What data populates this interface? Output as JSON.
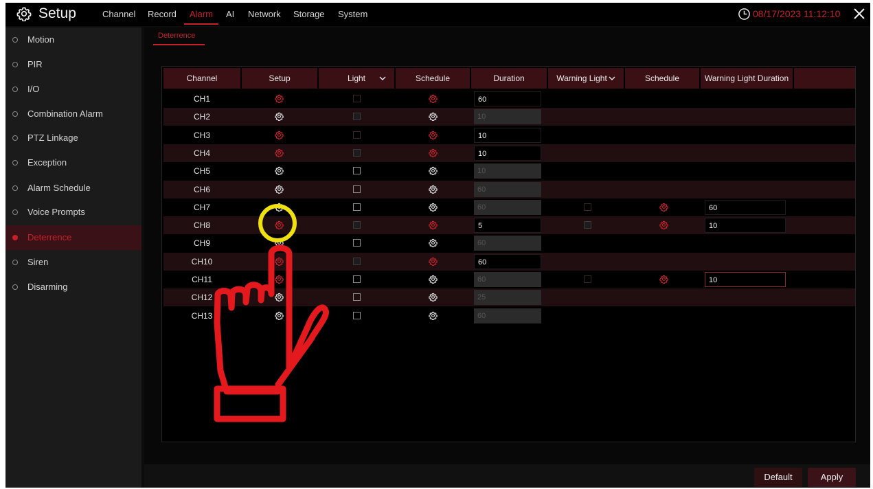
{
  "app": {
    "title": "Setup",
    "datetime": "08/17/2023 11:12:10"
  },
  "topnav": {
    "tabs": [
      {
        "label": "Channel",
        "active": false
      },
      {
        "label": "Record",
        "active": false
      },
      {
        "label": "Alarm",
        "active": true
      },
      {
        "label": "AI",
        "active": false
      },
      {
        "label": "Network",
        "active": false
      },
      {
        "label": "Storage",
        "active": false
      },
      {
        "label": "System",
        "active": false
      }
    ]
  },
  "sidebar": {
    "items": [
      {
        "label": "Motion",
        "active": false
      },
      {
        "label": "PIR",
        "active": false
      },
      {
        "label": "I/O",
        "active": false
      },
      {
        "label": "Combination Alarm",
        "active": false
      },
      {
        "label": "PTZ Linkage",
        "active": false
      },
      {
        "label": "Exception",
        "active": false
      },
      {
        "label": "Alarm Schedule",
        "active": false
      },
      {
        "label": "Voice Prompts",
        "active": false
      },
      {
        "label": "Deterrence",
        "active": true
      },
      {
        "label": "Siren",
        "active": false
      },
      {
        "label": "Disarming",
        "active": false
      }
    ]
  },
  "content": {
    "subtab": "Deterrence"
  },
  "table": {
    "headers": {
      "channel": "Channel",
      "setup": "Setup",
      "light": "Light",
      "schedule": "Schedule",
      "duration": "Duration",
      "warning_light": "Warning Light",
      "schedule2": "Schedule",
      "warning_light_duration": "Warning Light Duration"
    },
    "rows": [
      {
        "channel": "CH1",
        "setup": "red",
        "light": "dim",
        "schedule": "red",
        "duration": "60",
        "duration_state": "enabled",
        "warn": null
      },
      {
        "channel": "CH2",
        "setup": "white",
        "light": "filled",
        "schedule": "white",
        "duration": "10",
        "duration_state": "disabled",
        "warn": null
      },
      {
        "channel": "CH3",
        "setup": "red",
        "light": "dim",
        "schedule": "red",
        "duration": "10",
        "duration_state": "enabled",
        "warn": null
      },
      {
        "channel": "CH4",
        "setup": "red",
        "light": "filled",
        "schedule": "red",
        "duration": "10",
        "duration_state": "enabled",
        "warn": null
      },
      {
        "channel": "CH5",
        "setup": "white",
        "light": "empty",
        "schedule": "white",
        "duration": "10",
        "duration_state": "disabled",
        "warn": null
      },
      {
        "channel": "CH6",
        "setup": "white",
        "light": "empty",
        "schedule": "white",
        "duration": "60",
        "duration_state": "disabled",
        "warn": null
      },
      {
        "channel": "CH7",
        "setup": "white",
        "light": "empty",
        "schedule": "white",
        "duration": "60",
        "duration_state": "disabled",
        "warn": {
          "light": "dim",
          "duration": "60",
          "focus": false
        }
      },
      {
        "channel": "CH8",
        "setup": "red",
        "light": "filled",
        "schedule": "red",
        "duration": "5",
        "duration_state": "enabled",
        "warn": {
          "light": "filled",
          "duration": "10",
          "focus": false
        }
      },
      {
        "channel": "CH9",
        "setup": "white",
        "light": "empty",
        "schedule": "white",
        "duration": "60",
        "duration_state": "disabled",
        "warn": null
      },
      {
        "channel": "CH10",
        "setup": "red",
        "light": "filled",
        "schedule": "red",
        "duration": "60",
        "duration_state": "enabled",
        "warn": null
      },
      {
        "channel": "CH11",
        "setup": "red",
        "light": "empty",
        "schedule": "white",
        "duration": "60",
        "duration_state": "disabled",
        "warn": {
          "light": "dim",
          "duration": "10",
          "focus": true
        }
      },
      {
        "channel": "CH12",
        "setup": "white",
        "light": "empty",
        "schedule": "white",
        "duration": "25",
        "duration_state": "disabled",
        "warn": null
      },
      {
        "channel": "CH13",
        "setup": "white",
        "light": "empty",
        "schedule": "white",
        "duration": "60",
        "duration_state": "disabled",
        "warn": null
      }
    ]
  },
  "footer": {
    "default_label": "Default",
    "apply_label": "Apply"
  },
  "colors": {
    "accent": "#c8202a",
    "annotation_hand": "#e3191e",
    "annotation_circle": "#f0e010"
  }
}
